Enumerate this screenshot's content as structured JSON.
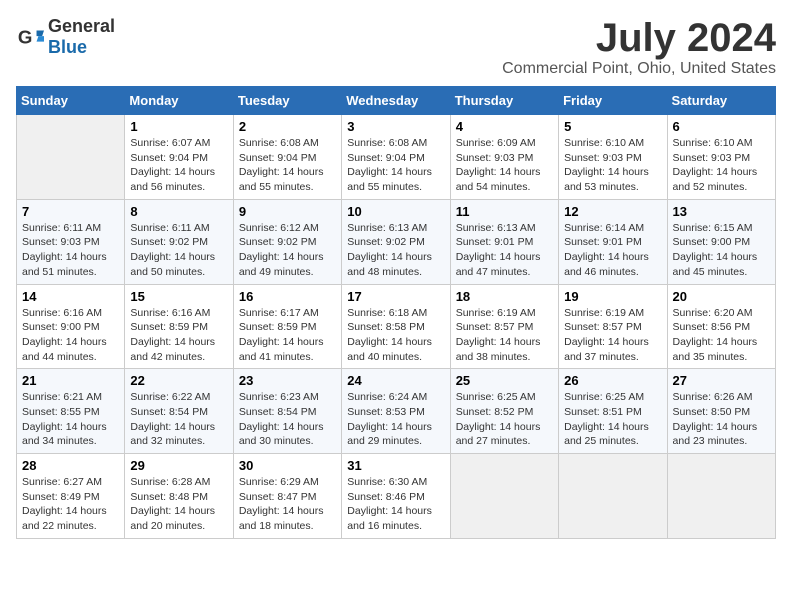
{
  "header": {
    "logo_general": "General",
    "logo_blue": "Blue",
    "main_title": "July 2024",
    "subtitle": "Commercial Point, Ohio, United States"
  },
  "days_of_week": [
    "Sunday",
    "Monday",
    "Tuesday",
    "Wednesday",
    "Thursday",
    "Friday",
    "Saturday"
  ],
  "weeks": [
    [
      {
        "day": "",
        "empty": true
      },
      {
        "day": "1",
        "sunrise": "6:07 AM",
        "sunset": "9:04 PM",
        "daylight": "14 hours and 56 minutes."
      },
      {
        "day": "2",
        "sunrise": "6:08 AM",
        "sunset": "9:04 PM",
        "daylight": "14 hours and 55 minutes."
      },
      {
        "day": "3",
        "sunrise": "6:08 AM",
        "sunset": "9:04 PM",
        "daylight": "14 hours and 55 minutes."
      },
      {
        "day": "4",
        "sunrise": "6:09 AM",
        "sunset": "9:03 PM",
        "daylight": "14 hours and 54 minutes."
      },
      {
        "day": "5",
        "sunrise": "6:10 AM",
        "sunset": "9:03 PM",
        "daylight": "14 hours and 53 minutes."
      },
      {
        "day": "6",
        "sunrise": "6:10 AM",
        "sunset": "9:03 PM",
        "daylight": "14 hours and 52 minutes."
      }
    ],
    [
      {
        "day": "7",
        "sunrise": "6:11 AM",
        "sunset": "9:03 PM",
        "daylight": "14 hours and 51 minutes."
      },
      {
        "day": "8",
        "sunrise": "6:11 AM",
        "sunset": "9:02 PM",
        "daylight": "14 hours and 50 minutes."
      },
      {
        "day": "9",
        "sunrise": "6:12 AM",
        "sunset": "9:02 PM",
        "daylight": "14 hours and 49 minutes."
      },
      {
        "day": "10",
        "sunrise": "6:13 AM",
        "sunset": "9:02 PM",
        "daylight": "14 hours and 48 minutes."
      },
      {
        "day": "11",
        "sunrise": "6:13 AM",
        "sunset": "9:01 PM",
        "daylight": "14 hours and 47 minutes."
      },
      {
        "day": "12",
        "sunrise": "6:14 AM",
        "sunset": "9:01 PM",
        "daylight": "14 hours and 46 minutes."
      },
      {
        "day": "13",
        "sunrise": "6:15 AM",
        "sunset": "9:00 PM",
        "daylight": "14 hours and 45 minutes."
      }
    ],
    [
      {
        "day": "14",
        "sunrise": "6:16 AM",
        "sunset": "9:00 PM",
        "daylight": "14 hours and 44 minutes."
      },
      {
        "day": "15",
        "sunrise": "6:16 AM",
        "sunset": "8:59 PM",
        "daylight": "14 hours and 42 minutes."
      },
      {
        "day": "16",
        "sunrise": "6:17 AM",
        "sunset": "8:59 PM",
        "daylight": "14 hours and 41 minutes."
      },
      {
        "day": "17",
        "sunrise": "6:18 AM",
        "sunset": "8:58 PM",
        "daylight": "14 hours and 40 minutes."
      },
      {
        "day": "18",
        "sunrise": "6:19 AM",
        "sunset": "8:57 PM",
        "daylight": "14 hours and 38 minutes."
      },
      {
        "day": "19",
        "sunrise": "6:19 AM",
        "sunset": "8:57 PM",
        "daylight": "14 hours and 37 minutes."
      },
      {
        "day": "20",
        "sunrise": "6:20 AM",
        "sunset": "8:56 PM",
        "daylight": "14 hours and 35 minutes."
      }
    ],
    [
      {
        "day": "21",
        "sunrise": "6:21 AM",
        "sunset": "8:55 PM",
        "daylight": "14 hours and 34 minutes."
      },
      {
        "day": "22",
        "sunrise": "6:22 AM",
        "sunset": "8:54 PM",
        "daylight": "14 hours and 32 minutes."
      },
      {
        "day": "23",
        "sunrise": "6:23 AM",
        "sunset": "8:54 PM",
        "daylight": "14 hours and 30 minutes."
      },
      {
        "day": "24",
        "sunrise": "6:24 AM",
        "sunset": "8:53 PM",
        "daylight": "14 hours and 29 minutes."
      },
      {
        "day": "25",
        "sunrise": "6:25 AM",
        "sunset": "8:52 PM",
        "daylight": "14 hours and 27 minutes."
      },
      {
        "day": "26",
        "sunrise": "6:25 AM",
        "sunset": "8:51 PM",
        "daylight": "14 hours and 25 minutes."
      },
      {
        "day": "27",
        "sunrise": "6:26 AM",
        "sunset": "8:50 PM",
        "daylight": "14 hours and 23 minutes."
      }
    ],
    [
      {
        "day": "28",
        "sunrise": "6:27 AM",
        "sunset": "8:49 PM",
        "daylight": "14 hours and 22 minutes."
      },
      {
        "day": "29",
        "sunrise": "6:28 AM",
        "sunset": "8:48 PM",
        "daylight": "14 hours and 20 minutes."
      },
      {
        "day": "30",
        "sunrise": "6:29 AM",
        "sunset": "8:47 PM",
        "daylight": "14 hours and 18 minutes."
      },
      {
        "day": "31",
        "sunrise": "6:30 AM",
        "sunset": "8:46 PM",
        "daylight": "14 hours and 16 minutes."
      },
      {
        "day": "",
        "empty": true
      },
      {
        "day": "",
        "empty": true
      },
      {
        "day": "",
        "empty": true
      }
    ]
  ]
}
